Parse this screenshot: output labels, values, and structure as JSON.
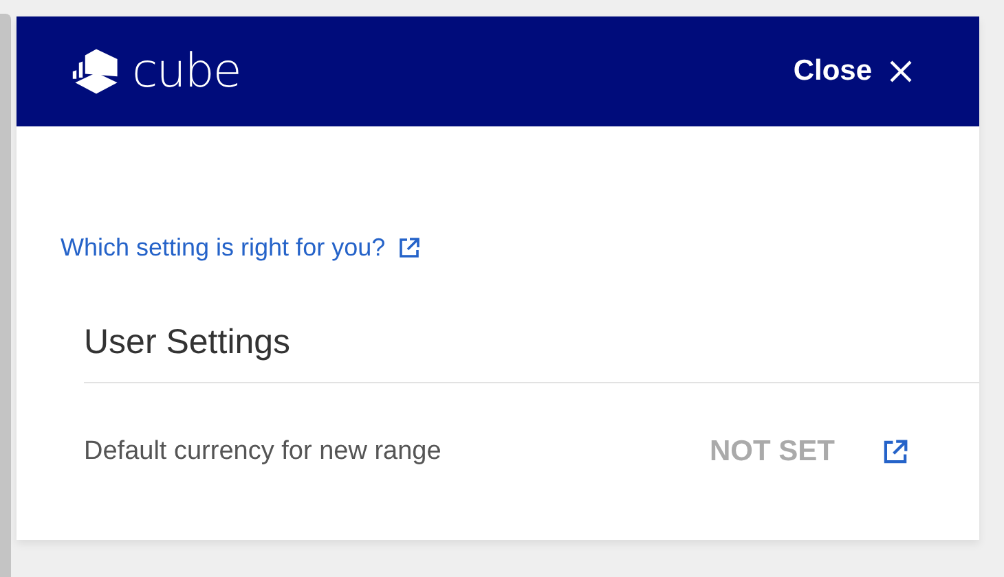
{
  "header": {
    "logo_text": "cube",
    "close_label": "Close"
  },
  "help_link": {
    "label": "Which setting is right for you?"
  },
  "section": {
    "title": "User Settings",
    "rows": [
      {
        "label": "Default currency for new range",
        "value": "NOT SET"
      }
    ]
  }
}
